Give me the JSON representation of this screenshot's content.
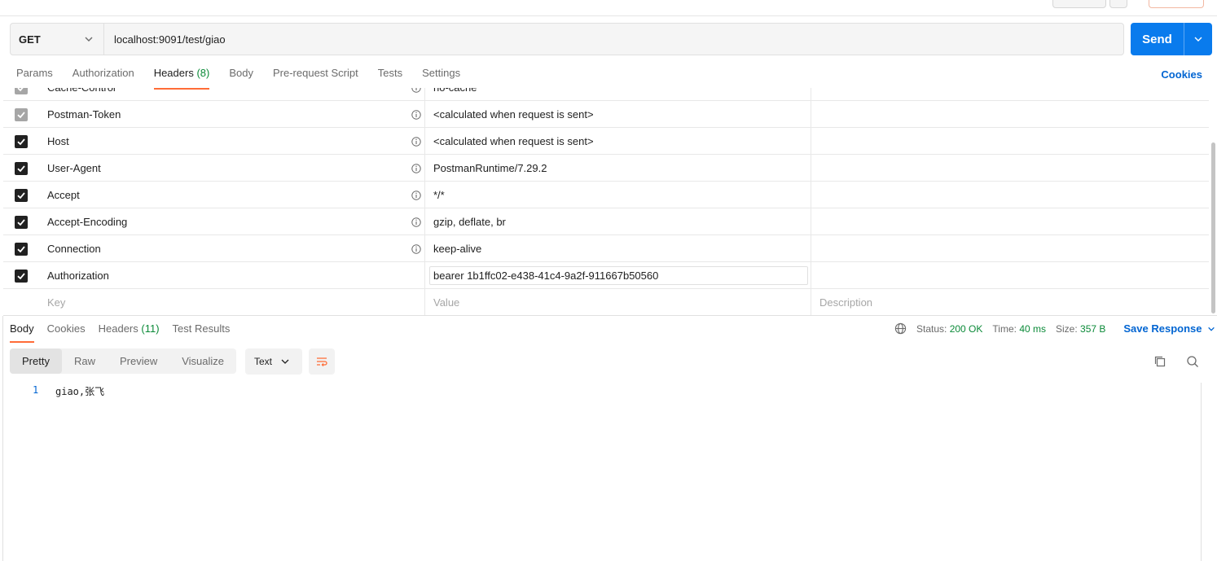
{
  "request": {
    "method": "GET",
    "url": "localhost:9091/test/giao",
    "send_label": "Send"
  },
  "request_tabs": [
    {
      "label": "Params"
    },
    {
      "label": "Authorization"
    },
    {
      "label": "Headers",
      "count": "(8)"
    },
    {
      "label": "Body"
    },
    {
      "label": "Pre-request Script"
    },
    {
      "label": "Tests"
    },
    {
      "label": "Settings"
    }
  ],
  "cookies_label": "Cookies",
  "headers": [
    {
      "key": "Cache-Control",
      "value": "no-cache",
      "enabled": true,
      "locked": true
    },
    {
      "key": "Postman-Token",
      "value": "<calculated when request is sent>",
      "enabled": true,
      "locked": true
    },
    {
      "key": "Host",
      "value": "<calculated when request is sent>",
      "enabled": true,
      "locked": false
    },
    {
      "key": "User-Agent",
      "value": "PostmanRuntime/7.29.2",
      "enabled": true,
      "locked": false
    },
    {
      "key": "Accept",
      "value": "*/*",
      "enabled": true,
      "locked": false
    },
    {
      "key": "Accept-Encoding",
      "value": "gzip, deflate, br",
      "enabled": true,
      "locked": false
    },
    {
      "key": "Connection",
      "value": "keep-alive",
      "enabled": true,
      "locked": false
    },
    {
      "key": "Authorization",
      "value": "bearer 1b1ffc02-e438-41c4-9a2f-911667b50560",
      "enabled": true,
      "locked": false
    }
  ],
  "new_row": {
    "key_placeholder": "Key",
    "value_placeholder": "Value",
    "desc_placeholder": "Description"
  },
  "response_tabs": [
    {
      "label": "Body"
    },
    {
      "label": "Cookies"
    },
    {
      "label": "Headers",
      "count": "(11)"
    },
    {
      "label": "Test Results"
    }
  ],
  "response_status": {
    "status_label": "Status:",
    "status_value": "200 OK",
    "time_label": "Time:",
    "time_value": "40 ms",
    "size_label": "Size:",
    "size_value": "357 B",
    "save_label": "Save Response"
  },
  "view_tabs": [
    "Pretty",
    "Raw",
    "Preview",
    "Visualize"
  ],
  "format": "Text",
  "body_lines": [
    {
      "no": "1",
      "text": "giao,张飞"
    }
  ],
  "colors": {
    "accent": "#ff6c37",
    "primary": "#097bed",
    "link": "#0265d2",
    "success": "#0b8a38"
  }
}
